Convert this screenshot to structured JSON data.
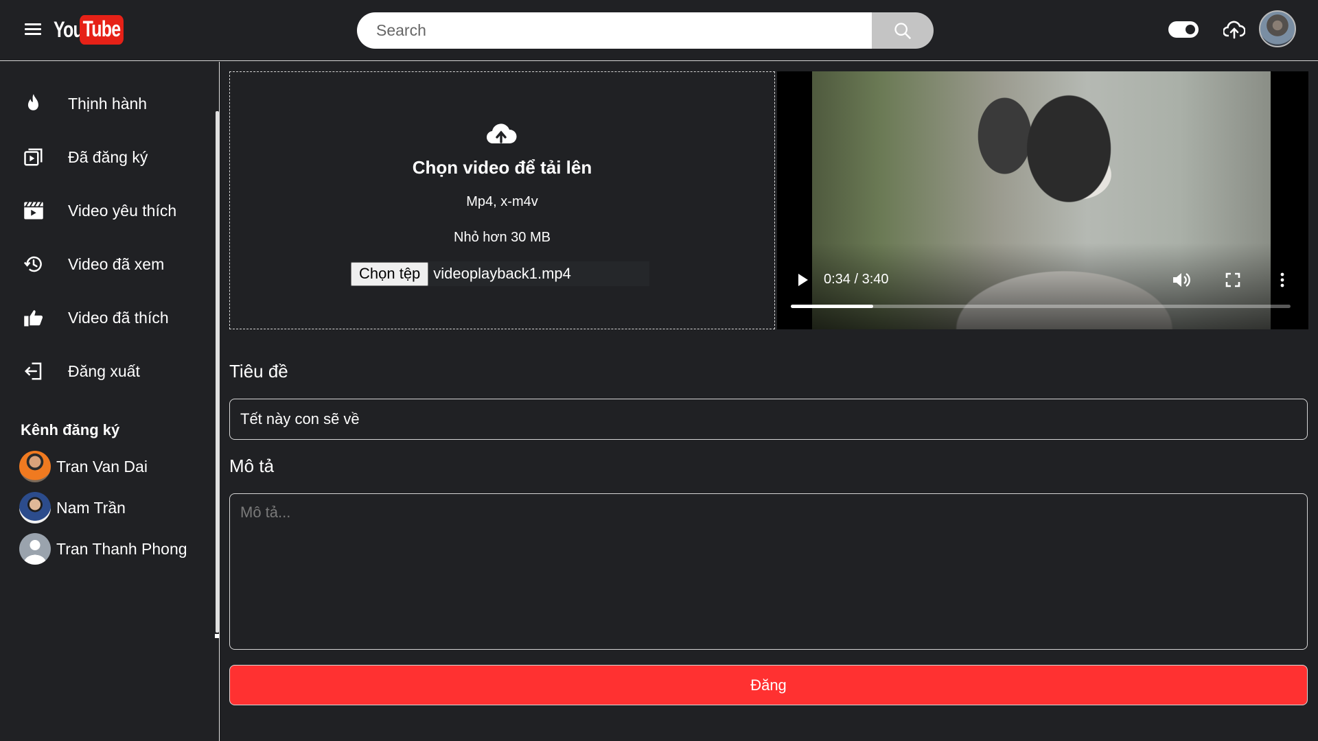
{
  "header": {
    "logo_you": "You",
    "logo_tube": "Tube",
    "search_placeholder": "Search"
  },
  "sidebar": {
    "items": [
      {
        "label": "Thịnh hành",
        "icon": "fire-icon"
      },
      {
        "label": "Đã đăng ký",
        "icon": "subscriptions-icon"
      },
      {
        "label": "Video yêu thích",
        "icon": "clapperboard-icon"
      },
      {
        "label": "Video đã xem",
        "icon": "history-icon"
      },
      {
        "label": "Video đã thích",
        "icon": "thumbs-up-icon"
      },
      {
        "label": "Đăng xuất",
        "icon": "logout-icon"
      }
    ],
    "channels_title": "Kênh đăng ký",
    "channels": [
      {
        "name": "Tran Van Dai"
      },
      {
        "name": "Nam Trần"
      },
      {
        "name": "Tran Thanh Phong"
      }
    ]
  },
  "upload": {
    "title": "Chọn video để tải lên",
    "formats": "Mp4, x-m4v",
    "size_limit": "Nhỏ hơn 30 MB",
    "choose_file_label": "Chọn tệp",
    "file_name": "videoplayback1.mp4"
  },
  "player": {
    "current_time": "0:34",
    "separator": " / ",
    "duration": "3:40",
    "progress": 0.165
  },
  "form": {
    "title_label": "Tiêu đề",
    "title_value": "Tết này con sẽ về",
    "description_label": "Mô tả",
    "description_placeholder": "Mô tả...",
    "submit_label": "Đăng"
  },
  "colors": {
    "background": "#202124",
    "accent": "#ff3131",
    "logo_red": "#e62117"
  }
}
